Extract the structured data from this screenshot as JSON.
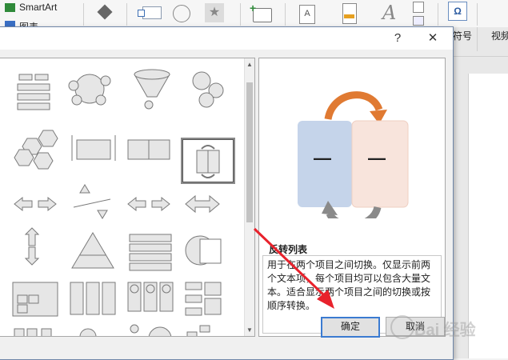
{
  "ribbon": {
    "smartart_label": "SmartArt",
    "chart_label_partial": "图表",
    "symbol_label": "符号",
    "video_label": "视频"
  },
  "dialog": {
    "help_label": "?",
    "close_label": "✕"
  },
  "preview": {
    "title": "反转列表",
    "description": "用于在两个项目之间切换。仅显示前两个文本项，每个项目均可以包含大量文本。适合显示两个项目之间的切换或按顺序转换。",
    "dash_left": "—",
    "dash_right": "—"
  },
  "buttons": {
    "ok": "确定",
    "cancel": "取消"
  },
  "colors": {
    "box_left": "#c5d4ea",
    "box_right": "#f8e4dc",
    "arrow_top": "#e07a32",
    "arrow_bottom": "#8a8a8a",
    "annotation_arrow": "#e8222c"
  }
}
